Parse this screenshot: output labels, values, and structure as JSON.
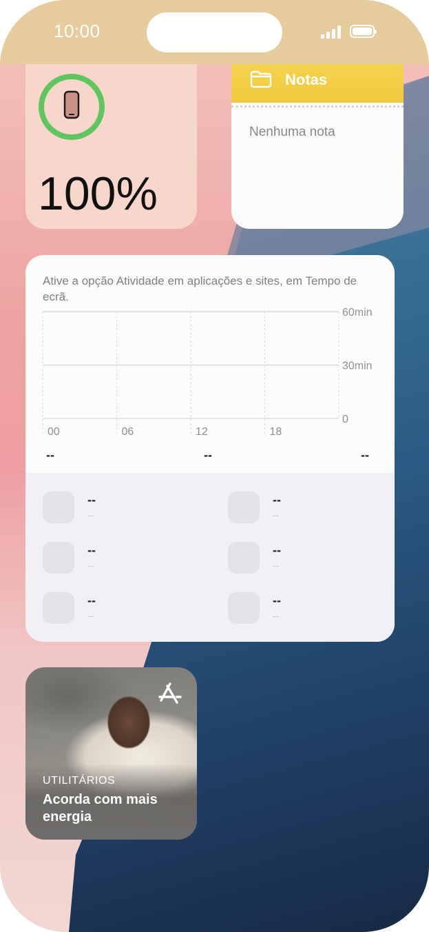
{
  "status_bar": {
    "time": "10:00"
  },
  "battery_widget": {
    "percent": "100%",
    "level": 1.0
  },
  "notes_widget": {
    "title": "Notas",
    "empty_text": "Nenhuma nota"
  },
  "screen_time_widget": {
    "message": "Ative a opção Atividade em aplicações e sites, em Tempo de ecrã.",
    "chart_data": {
      "type": "bar",
      "categories": [
        "00",
        "06",
        "12",
        "18"
      ],
      "y_ticks": [
        "60min",
        "30min",
        "0"
      ],
      "ylim": [
        0,
        60
      ],
      "values": [],
      "grid": true
    },
    "totals": [
      "--",
      "--",
      "--"
    ],
    "apps": [
      {
        "name": "--",
        "time": "--"
      },
      {
        "name": "--",
        "time": "--"
      },
      {
        "name": "--",
        "time": "--"
      },
      {
        "name": "--",
        "time": "--"
      },
      {
        "name": "--",
        "time": "--"
      },
      {
        "name": "--",
        "time": "--"
      }
    ]
  },
  "app_store_widget": {
    "category": "UTILITÁRIOS",
    "title": "Acorda com mais energia",
    "icon": "app-store-icon"
  },
  "colors": {
    "status_bar_bg": "#e6cb9c",
    "battery_ring": "#5fc65f",
    "notes_header": "#f3cd45"
  }
}
